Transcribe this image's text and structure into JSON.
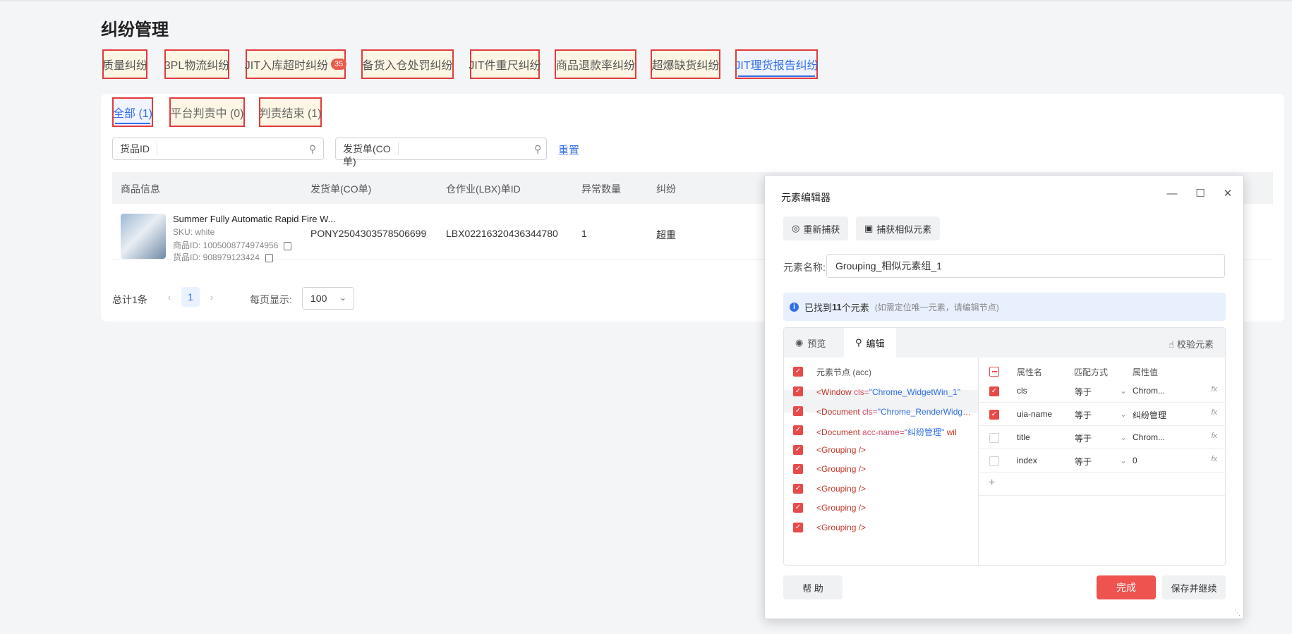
{
  "page": {
    "title": "纠纷管理"
  },
  "tabs": [
    {
      "label": "质量纠纷"
    },
    {
      "label": "3PL物流纠纷"
    },
    {
      "label": "JIT入库超时纠纷",
      "badge": "35"
    },
    {
      "label": "备货入仓处罚纠纷"
    },
    {
      "label": "JIT件重尺纠纷"
    },
    {
      "label": "商品退款率纠纷"
    },
    {
      "label": "超爆缺货纠纷"
    },
    {
      "label": "JIT理货报告纠纷"
    }
  ],
  "subtabs": [
    {
      "label": "全部 (1)"
    },
    {
      "label": "平台判责中 (0)"
    },
    {
      "label": "判责结束 (1)"
    }
  ],
  "filters": {
    "goods_id_label": "货品ID",
    "goods_id_value": "",
    "co_label": "发货单(CO单)",
    "co_value": "",
    "reset": "重置"
  },
  "table": {
    "headers": [
      "商品信息",
      "发货单(CO单)",
      "仓作业(LBX)单ID",
      "异常数量",
      "纠纷"
    ],
    "rows": [
      {
        "product_name": "Summer Fully Automatic Rapid Fire W...",
        "sku": "SKU: white",
        "product_id": "商品ID: 1005008774974956",
        "goods_id": "货品ID: 908979123424",
        "co": "PONY2504303578506699",
        "lbx": "LBX02216320436344780",
        "qty": "1",
        "dispute": "超重"
      }
    ]
  },
  "pagination": {
    "total": "总计1条",
    "prev": "‹",
    "page": "1",
    "next": "›",
    "per_page_label": "每页显示:",
    "per_page": "100"
  },
  "dialog": {
    "title": "元素编辑器",
    "recapture": "重新捕获",
    "capture_similar": "捕获相似元素",
    "name_label": "元素名称:",
    "name_value": "Grouping_相似元素组_1",
    "found_prefix": "已找到",
    "found_count": "11",
    "found_suffix": "个元素",
    "found_hint": "(如需定位唯一元素，请编辑节点)",
    "tab_preview": "预览",
    "tab_edit": "编辑",
    "verify": "校验元素",
    "nodes_header": "元素节点 (acc)",
    "nodes": [
      {
        "tag": "<Window ",
        "attr": "cls=",
        "val": "\"Chrome_WidgetWin_1\"",
        "rest": ""
      },
      {
        "tag": "<Document ",
        "attr": "cls=",
        "val": "\"Chrome_RenderWidgetHostHWND\"",
        "rest": ""
      },
      {
        "tag": "<Document ",
        "attr": "acc-name=",
        "val": "\"纠纷管理\"",
        "rest": " wil"
      },
      {
        "tag": "<Grouping />",
        "attr": "",
        "val": "",
        "rest": ""
      },
      {
        "tag": "<Grouping />",
        "attr": "",
        "val": "",
        "rest": ""
      },
      {
        "tag": "<Grouping />",
        "attr": "",
        "val": "",
        "rest": ""
      },
      {
        "tag": "<Grouping />",
        "attr": "",
        "val": "",
        "rest": ""
      },
      {
        "tag": "<Grouping />",
        "attr": "",
        "val": "",
        "rest": ""
      }
    ],
    "attr_headers": {
      "name": "属性名",
      "match": "匹配方式",
      "value": "属性值"
    },
    "attrs": [
      {
        "name": "cls",
        "match": "等于",
        "value": "Chrom...",
        "checked": true
      },
      {
        "name": "uia-name",
        "match": "等于",
        "value": "纠纷管理",
        "checked": true
      },
      {
        "name": "title",
        "match": "等于",
        "value": "Chrom...",
        "checked": false
      },
      {
        "name": "index",
        "match": "等于",
        "value": "0",
        "checked": false
      }
    ],
    "add": "+",
    "help": "帮 助",
    "done": "完成",
    "save_continue": "保存并继续"
  }
}
